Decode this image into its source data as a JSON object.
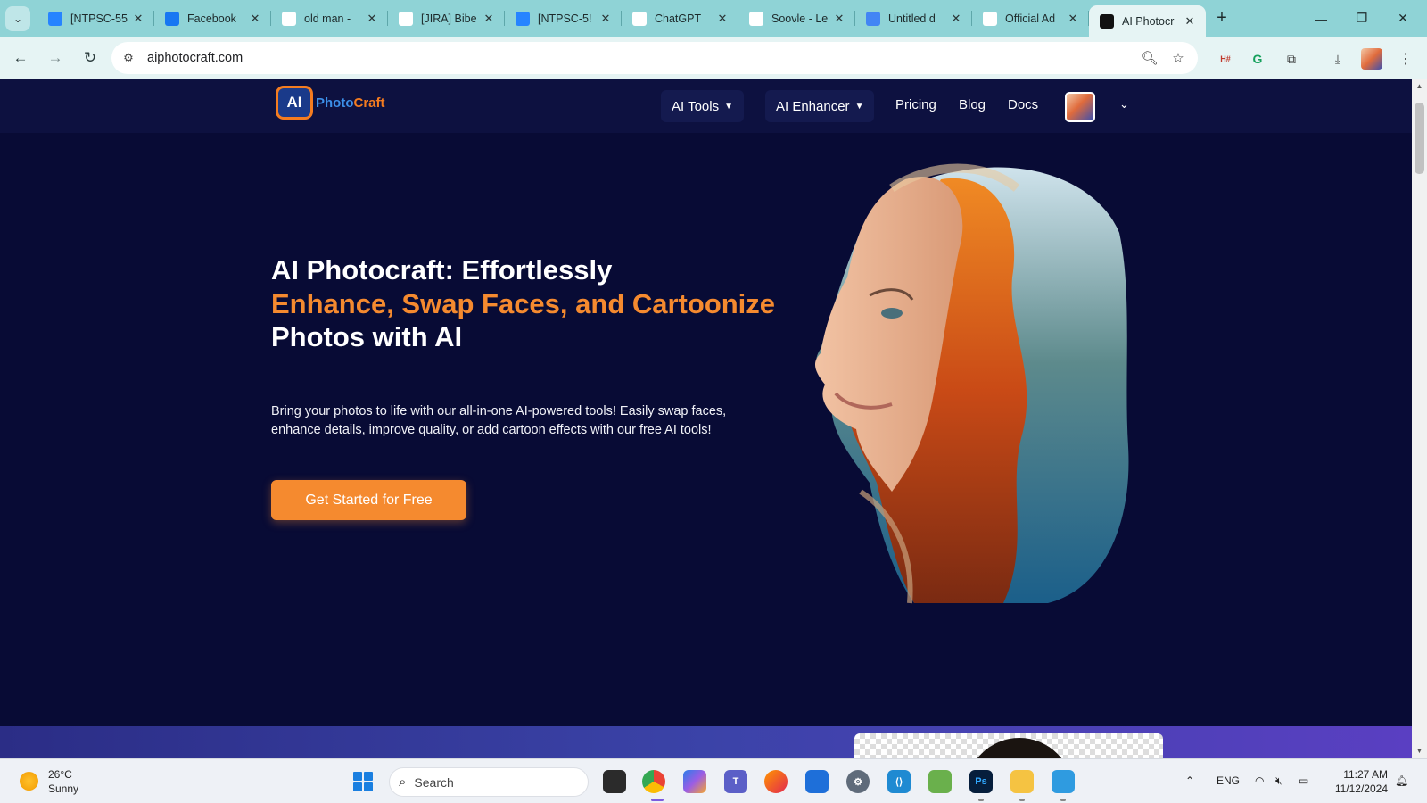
{
  "browser": {
    "tabs": [
      {
        "title": "[NTPSC-55",
        "icon": "jira-icon",
        "color": "#2684ff"
      },
      {
        "title": "Facebook",
        "icon": "facebook-icon",
        "color": "#1877f2"
      },
      {
        "title": "old man -",
        "icon": "google-icon",
        "color": "#ffffff"
      },
      {
        "title": "[JIRA] Bibe",
        "icon": "gmail-icon",
        "color": "#ffffff"
      },
      {
        "title": "[NTPSC-5!",
        "icon": "jira-icon",
        "color": "#2684ff"
      },
      {
        "title": "ChatGPT",
        "icon": "chatgpt-icon",
        "color": "#ffffff"
      },
      {
        "title": "Soovle - Le",
        "icon": "soovle-icon",
        "color": "#ffffff"
      },
      {
        "title": "Untitled d",
        "icon": "docs-icon",
        "color": "#4285f4"
      },
      {
        "title": "Official Ad",
        "icon": "adobe-icon",
        "color": "#ffffff"
      },
      {
        "title": "AI Photocr",
        "icon": "aiphotocraft-icon",
        "color": "#111111"
      }
    ],
    "active_tab_index": 9,
    "url": "aiphotocraft.com"
  },
  "site": {
    "logo": {
      "mark": "AI",
      "part1": "Photo",
      "part2": "Craft"
    },
    "nav": {
      "ai_tools": "AI Tools",
      "ai_enhancer": "AI Enhancer",
      "pricing": "Pricing",
      "blog": "Blog",
      "docs": "Docs"
    },
    "hero": {
      "line1": "AI Photocraft: Effortlessly",
      "line2": "Enhance, Swap Faces, and Cartoonize",
      "line3": "Photos with AI",
      "description": "Bring your photos to life with our all-in-one AI-powered tools! Easily swap faces, enhance details, improve quality, or add cartoon effects with our free AI tools!",
      "cta": "Get Started for Free"
    },
    "colors": {
      "accent": "#f58a2f",
      "background": "#080b35",
      "nav": "#0d1140"
    }
  },
  "taskbar": {
    "weather": {
      "temp": "26°C",
      "condition": "Sunny"
    },
    "search_label": "Search",
    "language": "ENG",
    "time": "11:27 AM",
    "date": "11/12/2024"
  }
}
